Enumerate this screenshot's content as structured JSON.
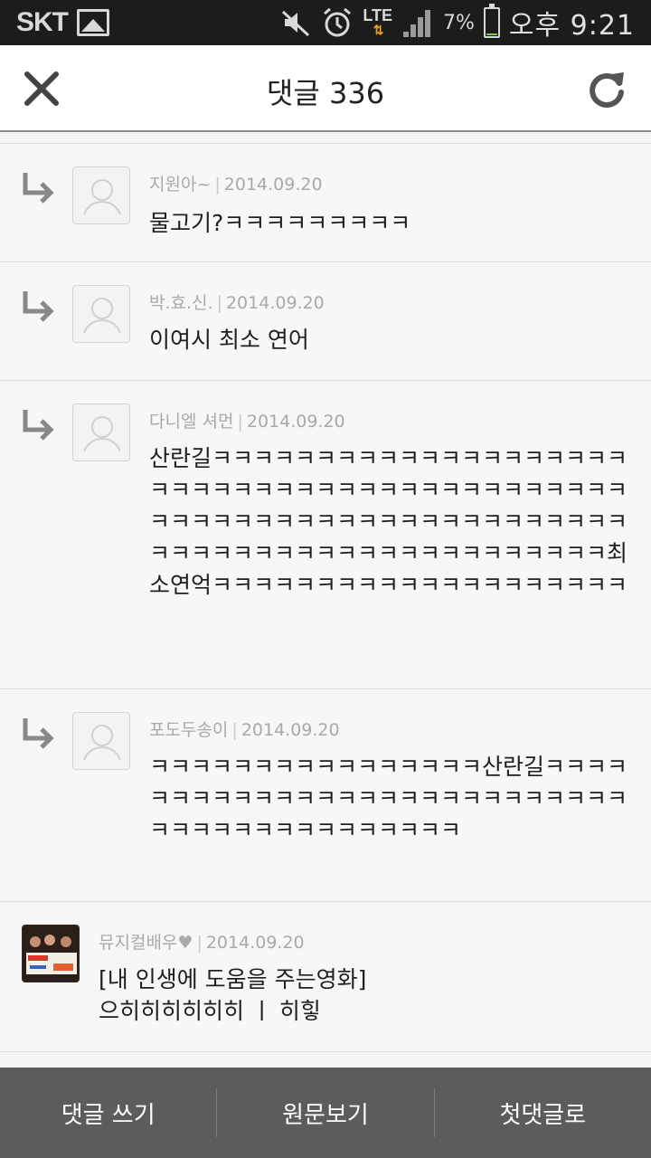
{
  "status_bar": {
    "carrier": "SKT",
    "battery_percent": "7%",
    "battery_level": 0.07,
    "network": "LTE",
    "time": "오후 9:21",
    "icons": [
      "gallery-icon",
      "mute-icon",
      "alarm-icon",
      "lte-icon",
      "signal-icon",
      "battery-icon"
    ]
  },
  "header": {
    "title": "댓글 336",
    "close_icon": "close-icon",
    "refresh_icon": "refresh-icon"
  },
  "comments": [
    {
      "reply": true,
      "author": "지원아~",
      "date": "2014.09.20",
      "text": "물고기?ㅋㅋㅋㅋㅋㅋㅋㅋㅋ"
    },
    {
      "reply": true,
      "author": "박.효.신.",
      "date": "2014.09.20",
      "text": "이여시 최소 연어"
    },
    {
      "reply": true,
      "author": "다니엘 셔먼",
      "date": "2014.09.20",
      "text": "산란길ㅋㅋㅋㅋㅋㅋㅋㅋㅋㅋㅋㅋㅋㅋㅋㅋㅋㅋㅋㅋㅋㅋㅋㅋㅋㅋㅋㅋㅋㅋㅋㅋㅋㅋㅋㅋㅋㅋㅋㅋㅋㅋㅋㅋㅋㅋㅋㅋㅋㅋㅋㅋㅋㅋㅋㅋㅋㅋㅋㅋㅋㅋㅋㅋㅋㅋㅋㅋㅋㅋㅋㅋㅋㅋㅋㅋㅋㅋㅋㅋㅋㅋㅋㅋㅋㅋㅋㅋ최소연억ㅋㅋㅋㅋㅋㅋㅋㅋㅋㅋㅋㅋㅋㅋㅋㅋㅋㅋㅋㅋ"
    },
    {
      "reply": true,
      "author": "포도두송이",
      "date": "2014.09.20",
      "text": " ㅋㅋㅋㅋㅋㅋㅋㅋㅋㅋㅋㅋㅋㅋㅋㅋ산란길ㅋㅋㅋㅋㅋㅋㅋㅋㅋㅋㅋㅋㅋㅋㅋㅋㅋㅋㅋㅋㅋㅋㅋㅋㅋㅋㅋㅋㅋㅋㅋㅋㅋㅋㅋㅋㅋㅋㅋㅋㅋㅋ"
    },
    {
      "reply": false,
      "author": "뮤지컬배우♥",
      "date": "2014.09.20",
      "text": "[내 인생에 도움을 주는영화]으히히히히히히 ㅣ 히힣"
    }
  ],
  "bottom_bar": {
    "write": "댓글 쓰기",
    "original": "원문보기",
    "first": "첫댓글로"
  }
}
